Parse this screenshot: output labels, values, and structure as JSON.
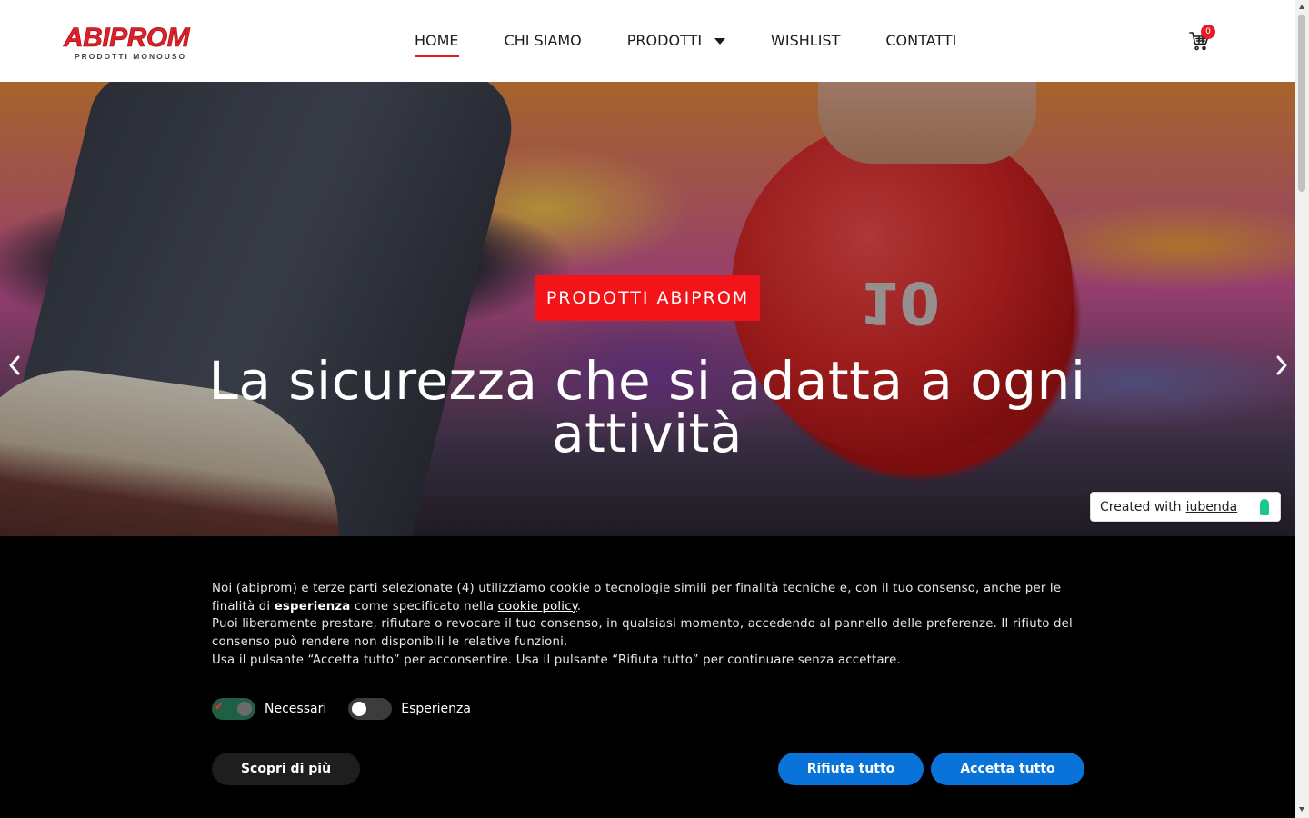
{
  "brand": {
    "name": "ABIPROM",
    "tagline": "PRODOTTI MONOUSO",
    "accent_color": "#e41e26"
  },
  "nav": {
    "items": [
      {
        "label": "HOME",
        "active": true
      },
      {
        "label": "CHI SIAMO",
        "active": false
      },
      {
        "label": "PRODOTTI",
        "active": false,
        "has_dropdown": true
      },
      {
        "label": "WISHLIST",
        "active": false
      },
      {
        "label": "CONTATTI",
        "active": false
      }
    ]
  },
  "cart": {
    "icon": "cart-icon",
    "count": "0"
  },
  "hero": {
    "badge": "PRODOTTI ABIPROM",
    "title": "La sicurezza che si adatta a ogni attività",
    "ball_number": "10",
    "prev_icon": "chevron-left-icon",
    "next_icon": "chevron-right-icon"
  },
  "iubenda": {
    "prefix": "Created with",
    "link": "iubenda"
  },
  "cookie": {
    "p1_a": "Noi (abiprom) e terze parti selezionate (4) utilizziamo cookie o tecnologie simili per finalità tecniche e, con il tuo consenso, anche per le finalità di ",
    "p1_bold": "esperienza",
    "p1_b": " come specificato nella ",
    "p1_link": "cookie policy",
    "p1_c": ".",
    "p2": "Puoi liberamente prestare, rifiutare o revocare il tuo consenso, in qualsiasi momento, accedendo al pannello delle preferenze. Il rifiuto del consenso può rendere non disponibili le relative funzioni.",
    "p3": "Usa il pulsante “Accetta tutto” per acconsentire. Usa il pulsante “Rifiuta tutto” per continuare senza accettare.",
    "toggles": [
      {
        "label": "Necessari",
        "on": true
      },
      {
        "label": "Esperienza",
        "on": false
      }
    ],
    "btn_more": "Scopri di più",
    "btn_reject": "Rifiuta tutto",
    "btn_accept": "Accetta tutto",
    "button_color": "#0a73d9"
  }
}
